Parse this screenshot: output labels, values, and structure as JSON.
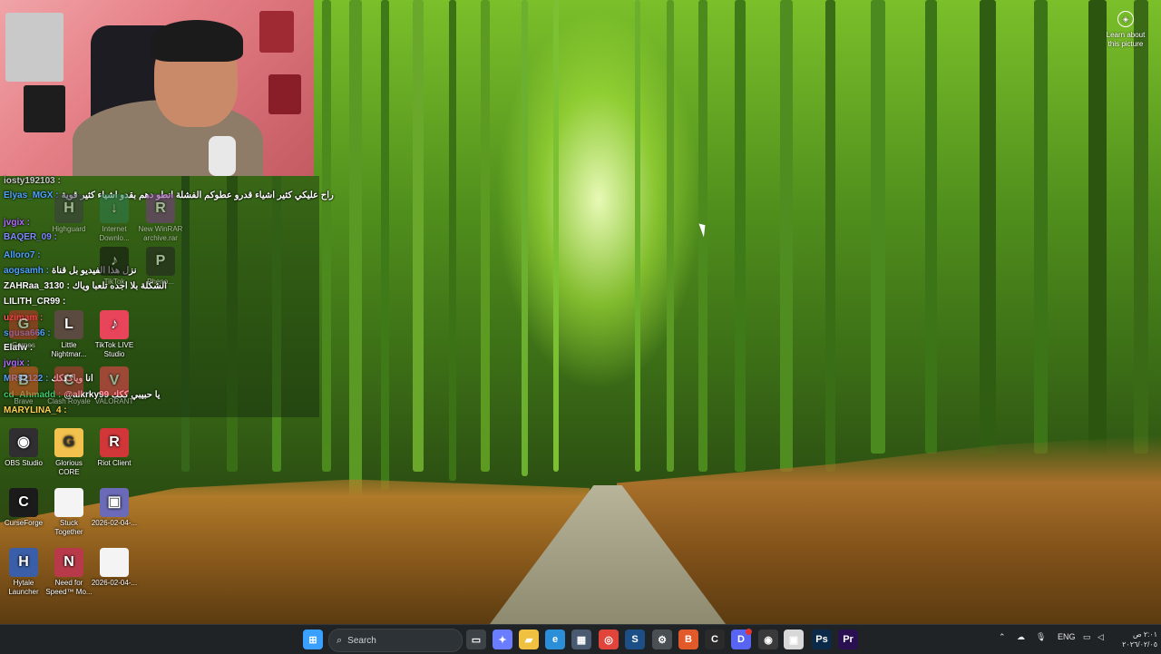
{
  "learn_about": {
    "line1": "Learn about",
    "line2": "this picture"
  },
  "chat": [
    {
      "user": "iosty192103 :",
      "msg": "",
      "color": "#c9c9c9"
    },
    {
      "user": "Elyas_MGX :",
      "msg": "راح عليكي كثير اشياء قدرو عطوكم الفشلة انطو دهم بقدو اشياء كثير قوية",
      "color": "#4da3ff"
    },
    {
      "user": "jvgix :",
      "msg": "",
      "color": "#b06bff"
    },
    {
      "user": "BAQER_09 :",
      "msg": "",
      "color": "#7f8cff"
    },
    {
      "user": "Alloro7 :",
      "msg": "",
      "color": "#4da3ff"
    },
    {
      "user": "aogsamh :",
      "msg": "نزل هذا الفيديو بل قناة",
      "color": "#4da3ff"
    },
    {
      "user": "ZAHRaa_3130 :",
      "msg": "الشكلة بلا اجده تلعبا وياك",
      "color": "#ffffff"
    },
    {
      "user": "LILITH_CR99 :",
      "msg": "",
      "color": "#ffffff"
    },
    {
      "user": "uzimam :",
      "msg": "",
      "color": "#ff5a5a"
    },
    {
      "user": "sgusa666 :",
      "msg": "",
      "color": "#4da3ff"
    },
    {
      "user": "Elafw :",
      "msg": "",
      "color": "#ffffff"
    },
    {
      "user": "jvgix :",
      "msg": "",
      "color": "#b06bff"
    },
    {
      "user": "MR92122 :",
      "msg": "انا وياكككك",
      "color": "#4da3ff"
    },
    {
      "user": "cd_Ahmadd :",
      "msg": "@alkrky99 يا حبيبي ككك",
      "color": "#3ecf6a"
    },
    {
      "user": "MARYLINA_4 :",
      "msg": "",
      "color": "#ffd24d"
    }
  ],
  "desktop_icons": [
    {
      "label": "Highguard",
      "glyph": "H",
      "bg": "#3a3d44",
      "faded": true
    },
    {
      "label": "Internet Downlo...",
      "glyph": "↓",
      "bg": "#2e7d4f",
      "faded": true
    },
    {
      "label": "New WinRAR archive.rar",
      "glyph": "R",
      "bg": "#7a3a8a",
      "faded": true
    },
    {
      "label": "TikTok",
      "glyph": "♪",
      "bg": "#111111",
      "faded": true
    },
    {
      "label": "Pheno...",
      "glyph": "P",
      "bg": "#222222",
      "faded": true
    },
    {
      "label": "Games",
      "glyph": "G",
      "bg": "#c0392b",
      "faded": true
    },
    {
      "label": "Little Nightmar...",
      "glyph": "L",
      "bg": "#5a4a40",
      "faded": false
    },
    {
      "label": "TikTok LIVE Studio",
      "glyph": "♪",
      "bg": "#e8455a",
      "faded": false
    },
    {
      "label": "Brave",
      "glyph": "B",
      "bg": "#e35a2a",
      "faded": true
    },
    {
      "label": "Clash Royale",
      "glyph": "C",
      "bg": "#c23b3b",
      "faded": true
    },
    {
      "label": "VALORANT",
      "glyph": "V",
      "bg": "#ff4655",
      "faded": true
    },
    {
      "label": "OBS Studio",
      "glyph": "◉",
      "bg": "#302e31",
      "faded": false
    },
    {
      "label": "Glorious CORE",
      "glyph": "G",
      "bg": "#f2c14e",
      "faded": false
    },
    {
      "label": "Riot Client",
      "glyph": "R",
      "bg": "#d13639",
      "faded": false
    },
    {
      "label": "CurseForge",
      "glyph": "C",
      "bg": "#1b1b1b",
      "faded": false
    },
    {
      "label": "Stuck Together",
      "glyph": "",
      "bg": "#f4f4f4",
      "faded": false
    },
    {
      "label": "2026-02-04-...",
      "glyph": "▣",
      "bg": "#6a6ab8",
      "faded": false
    },
    {
      "label": "Hytale Launcher",
      "glyph": "H",
      "bg": "#3a5ea8",
      "faded": false
    },
    {
      "label": "Need for Speed™ Mo...",
      "glyph": "N",
      "bg": "#b83a4a",
      "faded": false
    },
    {
      "label": "2026-02-04-...",
      "glyph": "",
      "bg": "#f4f4f4",
      "faded": false
    }
  ],
  "taskbar": {
    "search_placeholder": "Search",
    "apps": [
      {
        "name": "start-button",
        "glyph": "⊞",
        "bg": "#3aa0ff"
      },
      {
        "name": "task-view-button",
        "glyph": "▭",
        "bg": "#3c4246"
      },
      {
        "name": "copilot-button",
        "glyph": "✦",
        "bg": "#6a7dff"
      },
      {
        "name": "file-explorer-button",
        "glyph": "▰",
        "bg": "#f0c040"
      },
      {
        "name": "edge-button",
        "glyph": "e",
        "bg": "#2a8fd8"
      },
      {
        "name": "store-button",
        "glyph": "▦",
        "bg": "#4a5a70"
      },
      {
        "name": "chrome-button",
        "glyph": "◎",
        "bg": "#e0443a"
      },
      {
        "name": "steam-button",
        "glyph": "S",
        "bg": "#1b4f86"
      },
      {
        "name": "settings-button",
        "glyph": "⚙",
        "bg": "#4a4f54"
      },
      {
        "name": "brave-button",
        "glyph": "B",
        "bg": "#e35a2a"
      },
      {
        "name": "curseforge-button",
        "glyph": "C",
        "bg": "#2a2a2a"
      },
      {
        "name": "discord-button",
        "glyph": "D",
        "bg": "#5865f2"
      },
      {
        "name": "obs-button",
        "glyph": "◉",
        "bg": "#3a3a3a"
      },
      {
        "name": "app-button",
        "glyph": "▣",
        "bg": "#d8d8d8"
      },
      {
        "name": "photoshop-button",
        "glyph": "Ps",
        "bg": "#0b2a4a"
      },
      {
        "name": "premiere-button",
        "glyph": "Pr",
        "bg": "#2a1050"
      }
    ],
    "language": "ENG",
    "clock_time": "٢:٠١ ص",
    "clock_date": "٢٠٢٦/٠٢/٠٥"
  }
}
